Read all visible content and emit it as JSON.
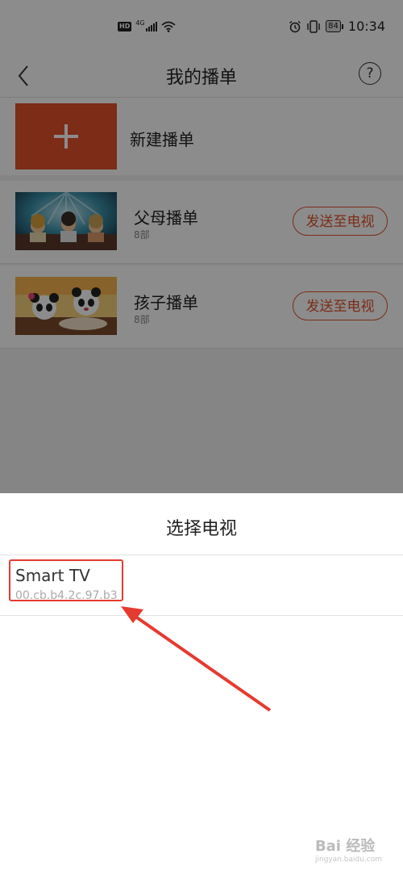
{
  "status_bar": {
    "hd": "HD",
    "network": "4G",
    "battery": "84",
    "time": "10:34",
    "icons": [
      "signal-icon",
      "wifi-icon",
      "alarm-icon",
      "vibrate-icon",
      "battery-icon"
    ]
  },
  "nav": {
    "title": "我的播单",
    "back_icon": "chevron-left-icon",
    "help_label": "?"
  },
  "new_playlist": {
    "label": "新建播单",
    "icon": "plus-icon",
    "accent": "#e2512b"
  },
  "playlists": [
    {
      "title": "父母播单",
      "count": "8部",
      "button": "发送至电视"
    },
    {
      "title": "孩子播单",
      "count": "8部",
      "button": "发送至电视"
    }
  ],
  "sheet": {
    "title": "选择电视",
    "devices": [
      {
        "name": "Smart TV",
        "mac": "00.cb.b4.2c.97.b3"
      }
    ]
  },
  "annotation": {
    "highlight_color": "#e53b2f"
  },
  "watermark": {
    "text": "Bai 经验",
    "sub": "jingyan.baidu.com"
  }
}
